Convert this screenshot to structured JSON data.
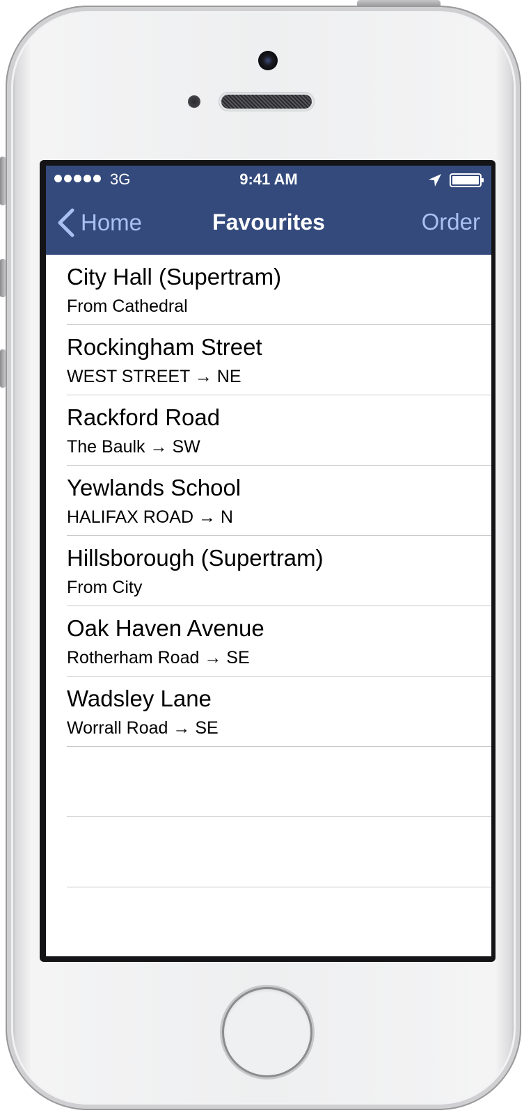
{
  "status_bar": {
    "carrier": "3G",
    "time": "9:41 AM",
    "signal_icon": "signal-dots-icon",
    "location_icon": "location-arrow-icon",
    "battery_icon": "battery-icon"
  },
  "nav": {
    "back_label": "Home",
    "back_icon": "chevron-left-icon",
    "title": "Favourites",
    "right_label": "Order"
  },
  "colors": {
    "navbar": "#344a7c",
    "nav_button": "#a9c0f2",
    "separator": "#c8c7cc"
  },
  "favourites": [
    {
      "title": "City Hall (Supertram)",
      "subtitle": "From Cathedral"
    },
    {
      "title": "Rockingham Street",
      "subtitle": "WEST STREET → NE"
    },
    {
      "title": "Rackford Road",
      "subtitle": "The Baulk → SW"
    },
    {
      "title": "Yewlands School",
      "subtitle": "HALIFAX ROAD → N"
    },
    {
      "title": "Hillsborough (Supertram)",
      "subtitle": "From City"
    },
    {
      "title": "Oak Haven Avenue",
      "subtitle": "Rotherham Road → SE"
    },
    {
      "title": "Wadsley Lane",
      "subtitle": "Worrall Road → SE"
    }
  ]
}
